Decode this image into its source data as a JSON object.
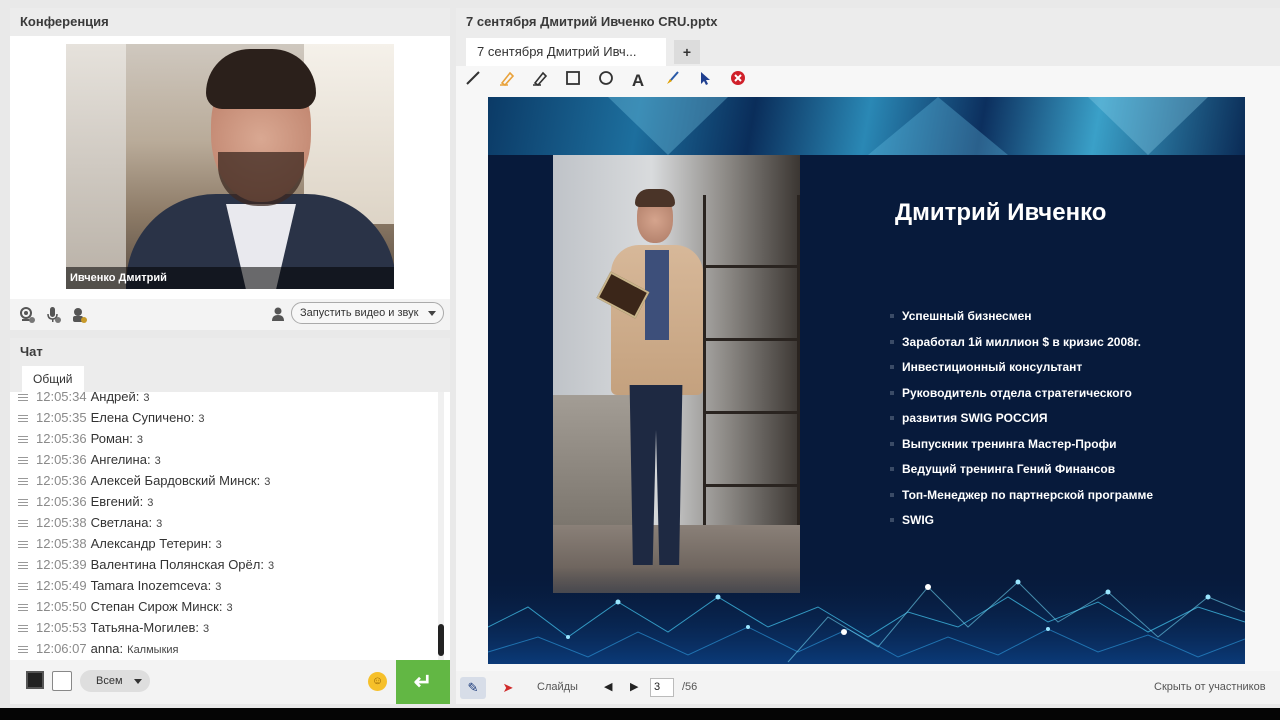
{
  "conference": {
    "title": "Конференция",
    "video_label": "Ивченко Дмитрий",
    "start_button": "Запустить видео и звук"
  },
  "chat": {
    "title": "Чат",
    "tab": "Общий",
    "messages": [
      {
        "time": "12:05:34",
        "name": "Андрей:",
        "text": "3"
      },
      {
        "time": "12:05:35",
        "name": "Елена Супичено:",
        "text": "3"
      },
      {
        "time": "12:05:36",
        "name": "Роман:",
        "text": "3"
      },
      {
        "time": "12:05:36",
        "name": "Ангелина:",
        "text": "3"
      },
      {
        "time": "12:05:36",
        "name": "Алексей Бардовский Минск:",
        "text": "3"
      },
      {
        "time": "12:05:36",
        "name": "Евгений:",
        "text": "3"
      },
      {
        "time": "12:05:38",
        "name": "Светлана:",
        "text": "3"
      },
      {
        "time": "12:05:38",
        "name": "Александр Тетерин:",
        "text": "3"
      },
      {
        "time": "12:05:39",
        "name": "Валентина Полянская Орёл:",
        "text": "3"
      },
      {
        "time": "12:05:49",
        "name": "Tamara  Inozemceva:",
        "text": "3"
      },
      {
        "time": "12:05:50",
        "name": "Степан  Сирож  Минск:",
        "text": "3"
      },
      {
        "time": "12:05:53",
        "name": "Татьяна-Могилев:",
        "text": "3"
      },
      {
        "time": "12:06:07",
        "name": "anna:",
        "text": "Калмыкия"
      }
    ],
    "recipient": "Всем",
    "send_icon": "enter-icon"
  },
  "presentation": {
    "title": "7 сентября Дмитрий Ивченко CRU.pptx",
    "tab_label": "7 сентября Дмитрий Ивч...",
    "tab_add": "+",
    "tools": [
      "line-icon",
      "highlighter-icon",
      "pencil-icon",
      "rectangle-icon",
      "circle-icon",
      "text-icon",
      "brush-icon",
      "pointer-icon",
      "clear-icon"
    ],
    "slide": {
      "name": "Дмитрий Ивченко",
      "bullets": [
        "Успешный бизнесмен",
        "Заработал  1й миллион $ в кризис 2008г.",
        "Инвестиционный консультант",
        "Руководитель отдела стратегического",
        "развития SWIG РОССИЯ",
        "Выпускник тренинга Мастер-Профи",
        "Ведущий тренинга Гений Финансов",
        "Топ-Менеджер по партнерской программе",
        "SWIG"
      ]
    },
    "bottom": {
      "slides_label": "Слайды",
      "current_page": "3",
      "total_pages": "/56",
      "hide_label": "Скрыть от участников"
    }
  },
  "colors": {
    "send_button": "#62b744",
    "slide_background": "#071a3b",
    "close_tool": "#d0202a"
  }
}
